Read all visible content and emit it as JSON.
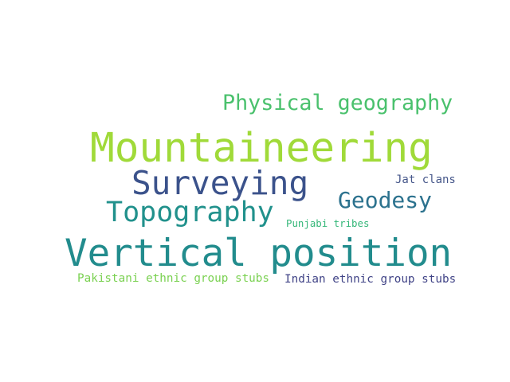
{
  "words": [
    {
      "text": "Physical geography",
      "color": "#4ac16d"
    },
    {
      "text": "Mountaineering",
      "color": "#a0da39"
    },
    {
      "text": "Surveying",
      "color": "#3b528b"
    },
    {
      "text": "Jat clans",
      "color": "#46578a"
    },
    {
      "text": "Geodesy",
      "color": "#2c728e"
    },
    {
      "text": "Topography",
      "color": "#21918c"
    },
    {
      "text": "Punjabi tribes",
      "color": "#35b779"
    },
    {
      "text": "Vertical position",
      "color": "#228c8d"
    },
    {
      "text": "Pakistani ethnic group stubs",
      "color": "#7ad151"
    },
    {
      "text": "Indian ethnic group stubs",
      "color": "#414487"
    }
  ]
}
